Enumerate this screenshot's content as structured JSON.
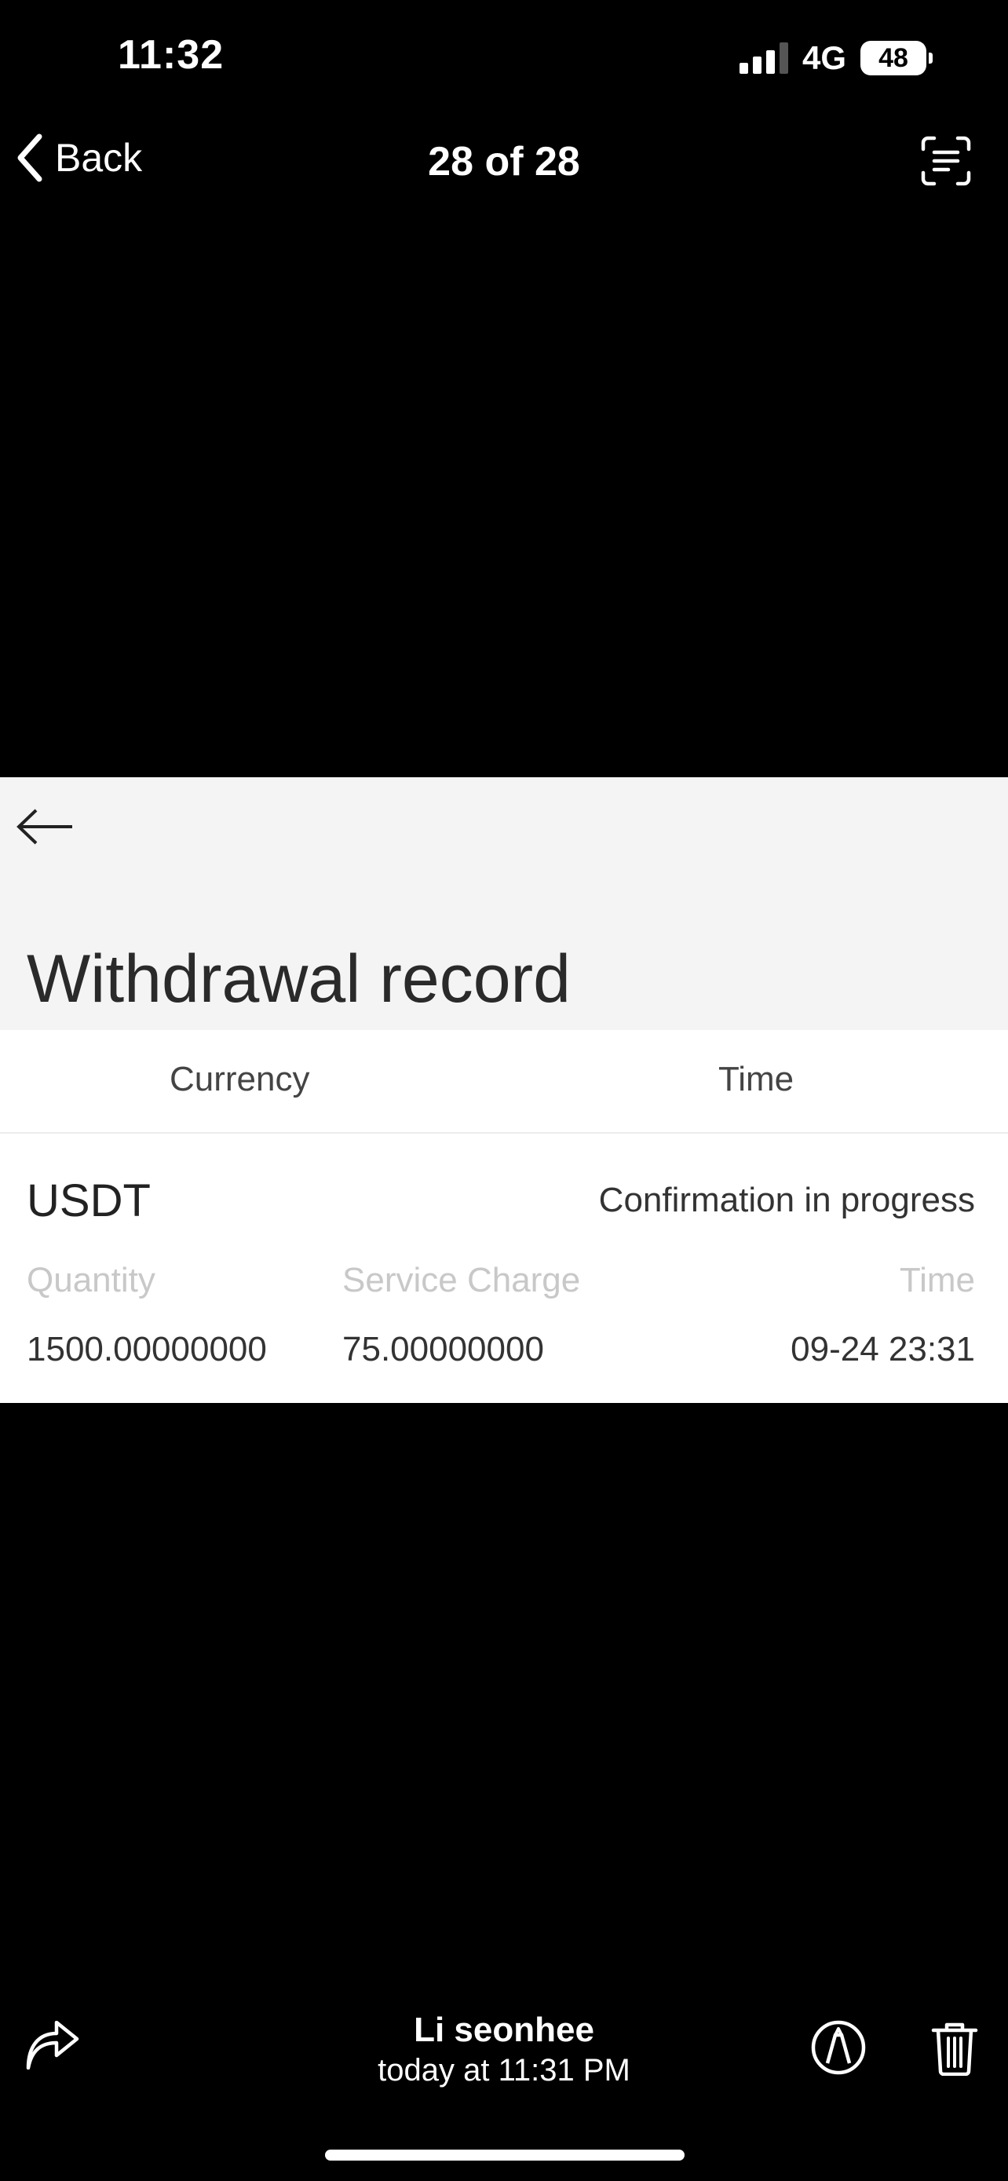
{
  "status_bar": {
    "time": "11:32",
    "network": "4G",
    "battery": "48",
    "signal_bars_active": 3,
    "signal_bars_total": 4
  },
  "nav": {
    "back_label": "Back",
    "title": "28 of 28",
    "back_icon": "chevron-left-icon",
    "scan_icon": "live-text-icon"
  },
  "photo": {
    "back_icon": "arrow-left-icon",
    "title": "Withdrawal record",
    "columns": [
      "Currency",
      "Time"
    ],
    "record": {
      "currency": "USDT",
      "status": "Confirmation in progress",
      "labels": [
        "Quantity",
        "Service Charge",
        "Time"
      ],
      "values": [
        "1500.00000000",
        "75.00000000",
        "09-24 23:31"
      ]
    }
  },
  "footer": {
    "sender": "Li seonhee",
    "timestamp": "today at 11:31 PM",
    "share_icon": "share-icon",
    "markup_icon": "markup-icon",
    "trash_icon": "trash-icon"
  },
  "colors": {
    "background": "#000000",
    "photo_header_bg": "#f4f4f4",
    "label_gray": "#c8c8c8"
  }
}
